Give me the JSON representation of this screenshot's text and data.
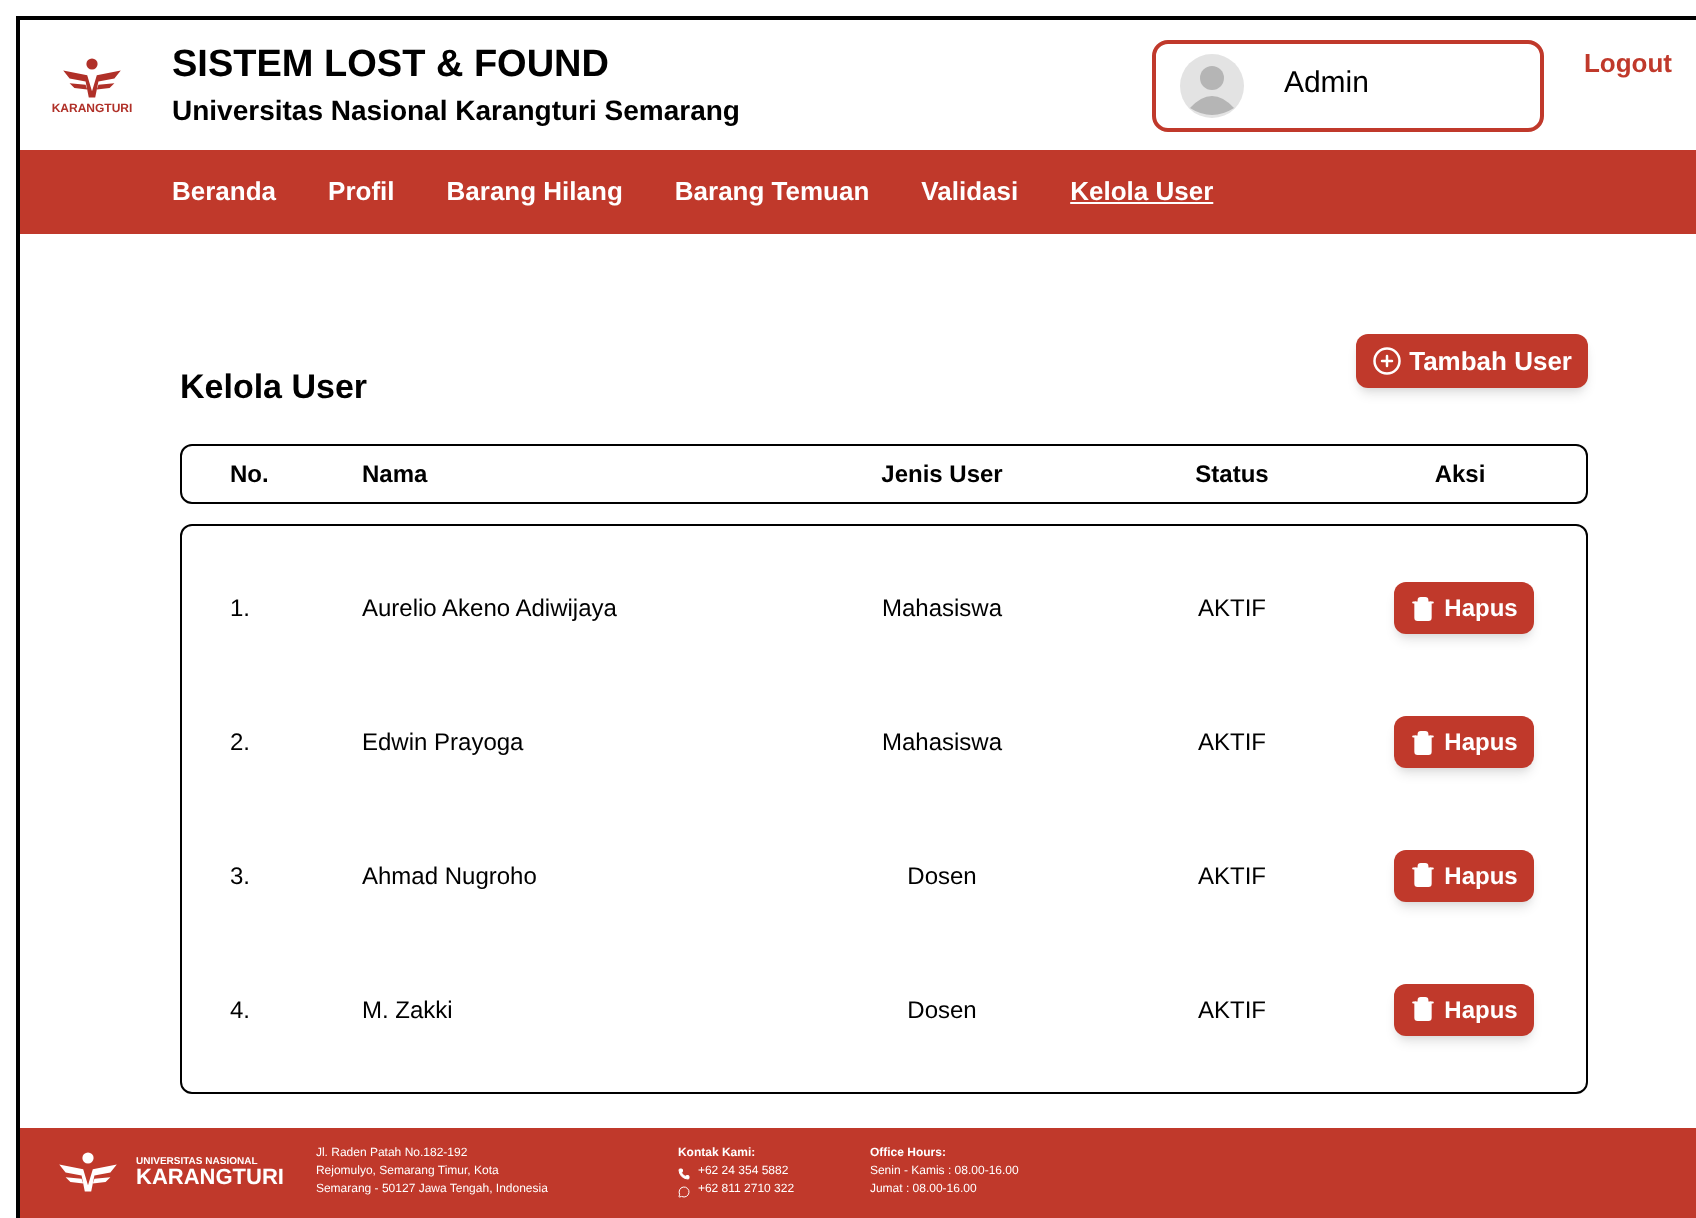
{
  "header": {
    "logo_text": "KARANGTURI",
    "title": "SISTEM LOST & FOUND",
    "subtitle": "Universitas Nasional Karangturi Semarang",
    "user": "Admin",
    "logout": "Logout"
  },
  "nav": [
    {
      "label": "Beranda",
      "selected": false
    },
    {
      "label": "Profil",
      "selected": false
    },
    {
      "label": "Barang Hilang",
      "selected": false
    },
    {
      "label": "Barang Temuan",
      "selected": false
    },
    {
      "label": "Validasi",
      "selected": false
    },
    {
      "label": "Kelola User",
      "selected": true
    }
  ],
  "page": {
    "title": "Kelola User",
    "add_button": "Tambah User"
  },
  "table": {
    "columns": [
      "No.",
      "Nama",
      "Jenis User",
      "Status",
      "Aksi"
    ],
    "rows": [
      {
        "no": "1.",
        "name": "Aurelio Akeno Adiwijaya",
        "type": "Mahasiswa",
        "status": "AKTIF",
        "action": "Hapus"
      },
      {
        "no": "2.",
        "name": "Edwin Prayoga",
        "type": "Mahasiswa",
        "status": "AKTIF",
        "action": "Hapus"
      },
      {
        "no": "3.",
        "name": "Ahmad Nugroho",
        "type": "Dosen",
        "status": "AKTIF",
        "action": "Hapus"
      },
      {
        "no": "4.",
        "name": "M. Zakki",
        "type": "Dosen",
        "status": "AKTIF",
        "action": "Hapus"
      }
    ]
  },
  "footer": {
    "logo_top": "UNIVERSITAS NASIONAL",
    "logo_bottom": "KARANGTURI",
    "address": [
      "Jl. Raden Patah No.182-192",
      "Rejomulyo, Semarang Timur, Kota",
      "Semarang - 50127 Jawa Tengah, Indonesia"
    ],
    "contact_title": "Kontak Kami:",
    "phone": "+62 24 354 5882",
    "whatsapp": "+62 811 2710 322",
    "hours_title": "Office Hours:",
    "hours": [
      "Senin - Kamis : 08.00-16.00",
      "Jumat : 08.00-16.00"
    ]
  }
}
